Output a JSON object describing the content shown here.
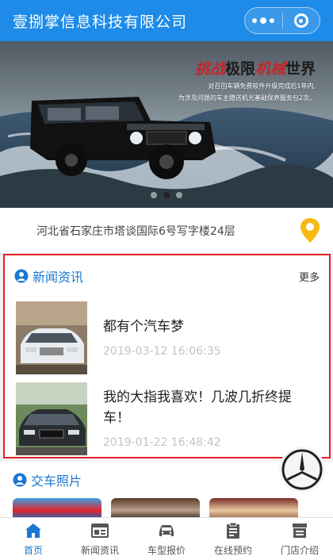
{
  "navbar": {
    "title": "壹捌掌信息科技有限公司"
  },
  "banner": {
    "slogan_red1": "挑战",
    "slogan_black1": "极限",
    "slogan_red2": "机械",
    "slogan_black2": "世界",
    "slogan_line1": "对召回车辆免费软件升级完成后1年内,",
    "slogan_line2": "为涉及问题的车主赠送机光基础保养服务包2次。",
    "active_slide": 1,
    "slide_count": 3
  },
  "address": {
    "text": "河北省石家庄市塔谈国际6号写字楼24层"
  },
  "news": {
    "title": "新闻资讯",
    "more": "更多",
    "items": [
      {
        "title": "都有个汽车梦",
        "date": "2019-03-12 16:06:35"
      },
      {
        "title": "我的大指我喜欢！几波几折终提车！",
        "date": "2019-01-22 16:48:42"
      }
    ]
  },
  "photos": {
    "title": "交车照片"
  },
  "tabbar": {
    "items": [
      {
        "label": "首页",
        "icon": "home-icon"
      },
      {
        "label": "新闻资讯",
        "icon": "news-icon"
      },
      {
        "label": "车型报价",
        "icon": "car-icon"
      },
      {
        "label": "在线预约",
        "icon": "clipboard-icon"
      },
      {
        "label": "门店介绍",
        "icon": "store-icon"
      }
    ]
  },
  "colors": {
    "primary": "#1e8be8",
    "highlight_border": "#e41e25",
    "accent_text": "#1a78d2"
  }
}
